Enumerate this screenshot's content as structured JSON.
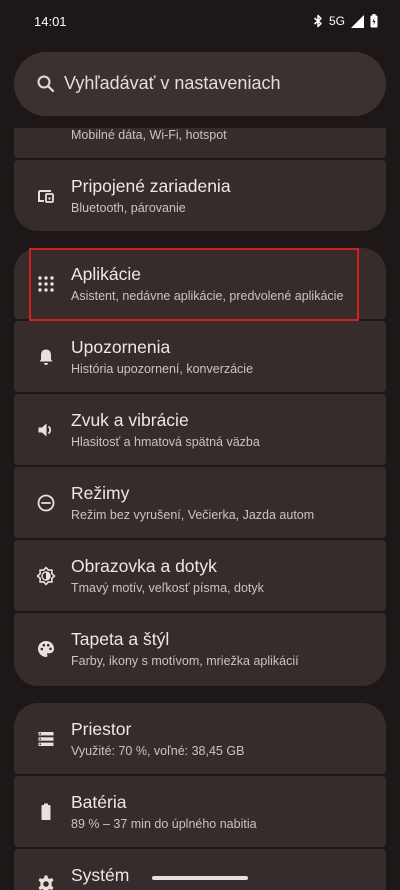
{
  "status_bar": {
    "time": "14:01",
    "network": "5G",
    "icons": [
      "bluetooth-icon",
      "signal-icon",
      "battery-icon"
    ]
  },
  "search": {
    "placeholder": "Vyhľadávať v nastaveniach",
    "icon": "search-icon"
  },
  "settings": [
    {
      "title": "",
      "subtitle": "Mobilné dáta, Wi-Fi, hotspot",
      "icon": "network-icon"
    },
    {
      "title": "Pripojené zariadenia",
      "subtitle": "Bluetooth, párovanie",
      "icon": "devices-icon"
    },
    {
      "title": "Aplikácie",
      "subtitle": "Asistent, nedávne aplikácie, predvolené aplikácie",
      "icon": "apps-grid-icon"
    },
    {
      "title": "Upozornenia",
      "subtitle": "História upozornení, konverzácie",
      "icon": "bell-icon"
    },
    {
      "title": "Zvuk a vibrácie",
      "subtitle": "Hlasitosť a hmatová spätná väzba",
      "icon": "volume-icon"
    },
    {
      "title": "Režimy",
      "subtitle": "Režim bez vyrušení, Večierka, Jazda autom",
      "icon": "modes-icon"
    },
    {
      "title": "Obrazovka a dotyk",
      "subtitle": "Tmavý motív, veľkosť písma, dotyk",
      "icon": "brightness-icon"
    },
    {
      "title": "Tapeta a štýl",
      "subtitle": "Farby, ikony s motívom, mriežka aplikácií",
      "icon": "palette-icon"
    },
    {
      "title": "Priestor",
      "subtitle": "Využité: 70 %, voľné: 38,45 GB",
      "icon": "storage-icon"
    },
    {
      "title": "Batéria",
      "subtitle": "89 % – 37 min do úplného nabitia",
      "icon": "battery-icon"
    },
    {
      "title": "Systém",
      "subtitle": "",
      "icon": "system-gear-icon"
    }
  ],
  "colors": {
    "background": "#1d1817",
    "card": "#352c2b",
    "search": "#3b3130",
    "highlight": "#d51f1f"
  }
}
